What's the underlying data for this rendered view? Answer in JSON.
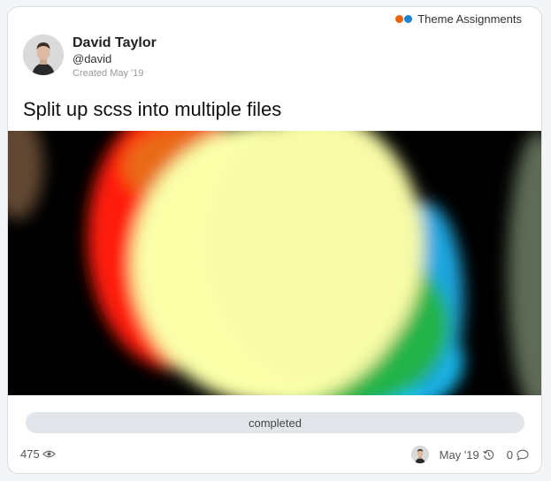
{
  "category": {
    "label": "Theme Assignments",
    "colors": [
      "#e8650e",
      "#1a82d4"
    ]
  },
  "author": {
    "name": "David Taylor",
    "handle": "@david",
    "created": "Created May '19"
  },
  "post": {
    "title": "Split up scss into multiple files"
  },
  "status": {
    "label": "completed"
  },
  "footer": {
    "views": "475",
    "last_activity": "May '19",
    "replies": "0"
  },
  "icons": {
    "views": "eye-icon",
    "activity": "history-icon",
    "replies": "comment-icon"
  }
}
